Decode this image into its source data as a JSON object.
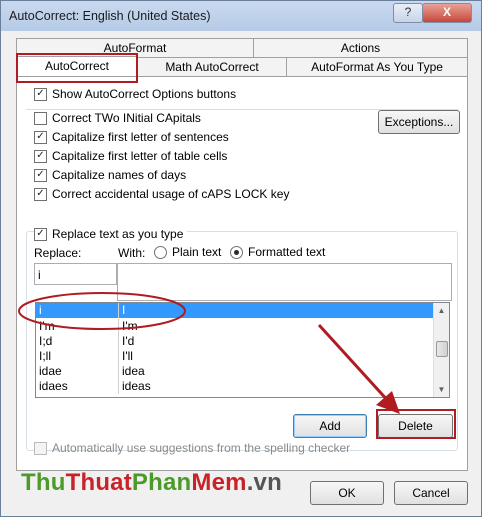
{
  "window": {
    "title": "AutoCorrect: English (United States)",
    "help_glyph": "?",
    "close_glyph": "X"
  },
  "tabs": {
    "row_back": [
      {
        "label": "AutoFormat"
      },
      {
        "label": "Actions"
      }
    ],
    "row_front": [
      {
        "label": "AutoCorrect"
      },
      {
        "label": "Math AutoCorrect"
      },
      {
        "label": "AutoFormat As You Type"
      }
    ],
    "active": "AutoCorrect"
  },
  "options": {
    "show_buttons": {
      "label": "Show AutoCorrect Options buttons",
      "checked": true
    },
    "two_initial": {
      "label": "Correct TWo INitial CApitals",
      "checked": false
    },
    "first_sentence": {
      "label": "Capitalize first letter of sentences",
      "checked": true
    },
    "first_table_cell": {
      "label": "Capitalize first letter of table cells",
      "checked": true
    },
    "names_days": {
      "label": "Capitalize names of days",
      "checked": true
    },
    "caps_lock": {
      "label": "Correct accidental usage of cAPS LOCK key",
      "checked": true
    },
    "exceptions_label": "Exceptions...",
    "check_glyph": "✓"
  },
  "replace_section": {
    "replace_as_you_type": {
      "label": "Replace text as you type",
      "checked": true
    },
    "replace_label": "Replace:",
    "with_label": "With:",
    "plain_text": "Plain text",
    "formatted_text": "Formatted text",
    "formatted_selected": true,
    "replace_value": "i",
    "with_value": ""
  },
  "entries": [
    {
      "replace": "i",
      "with": "I",
      "selected": true
    },
    {
      "replace": "I'm",
      "with": "I'm",
      "selected": false
    },
    {
      "replace": "I;d",
      "with": "I'd",
      "selected": false
    },
    {
      "replace": "I;ll",
      "with": "I'll",
      "selected": false
    },
    {
      "replace": "idae",
      "with": "idea",
      "selected": false
    },
    {
      "replace": "idaes",
      "with": "ideas",
      "selected": false
    }
  ],
  "scroll": {
    "up_glyph": "▲",
    "down_glyph": "▼"
  },
  "buttons": {
    "add": "Add",
    "delete": "Delete",
    "ok": "OK",
    "cancel": "Cancel"
  },
  "spelling": {
    "label": "Automatically use suggestions from the spelling checker",
    "checked": false,
    "enabled": false
  },
  "watermark": {
    "part1": "Thu",
    "part2": "Thuat",
    "part3": "Phan",
    "part4": "Mem",
    "part5": ".vn"
  },
  "colors": {
    "highlight": "#3399ff",
    "annotation_red": "#b01c22",
    "wm_green": "#4c9a2a",
    "wm_red": "#c7242a"
  }
}
